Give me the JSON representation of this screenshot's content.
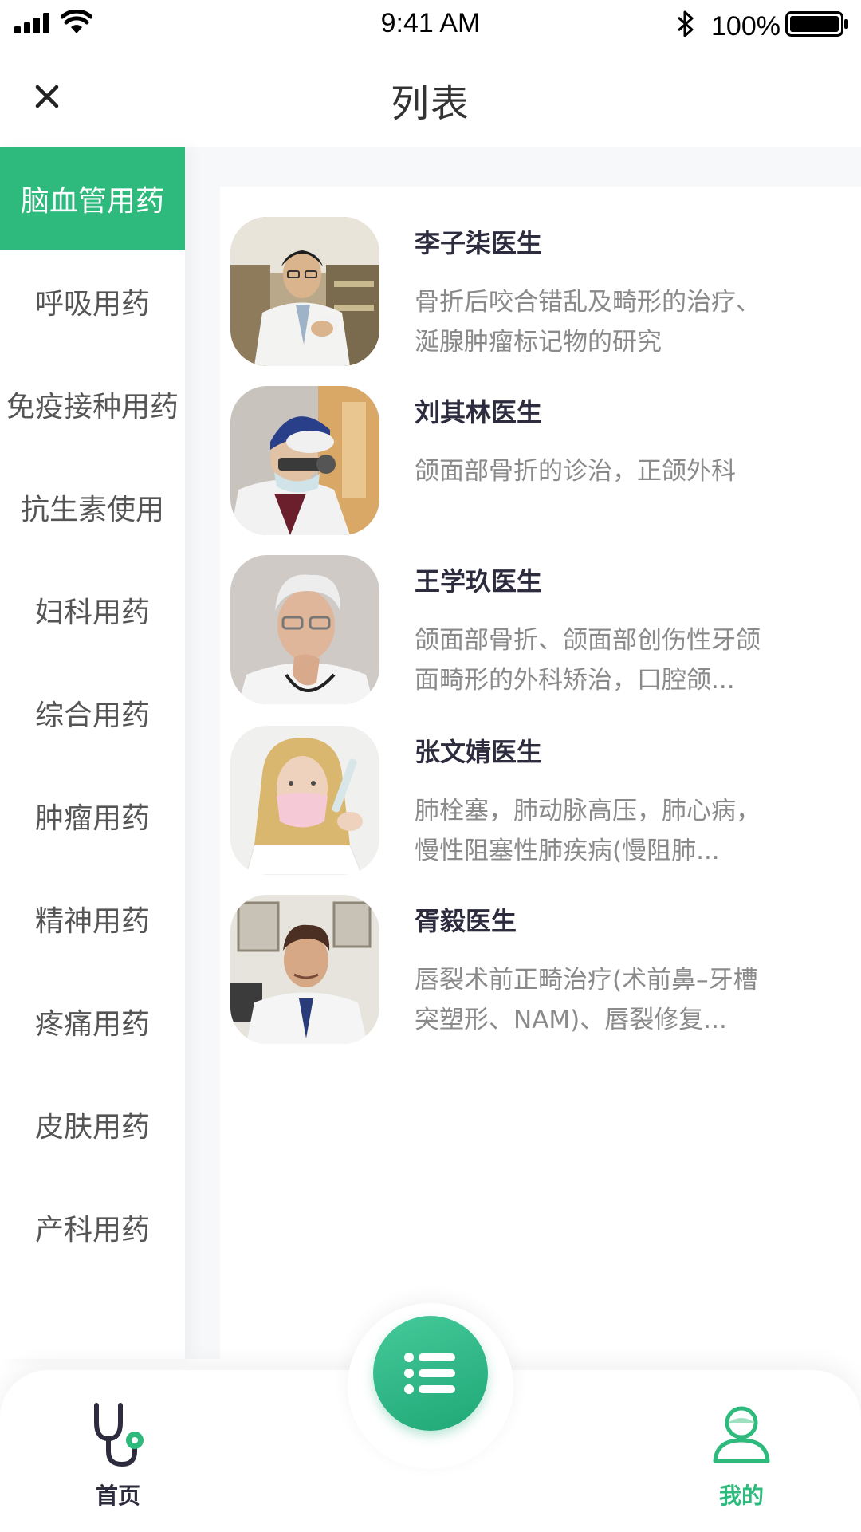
{
  "status_bar": {
    "time": "9:41 AM",
    "battery_percent": "100%",
    "icons": [
      "signal-icon",
      "wifi-icon",
      "bluetooth-icon",
      "battery-icon"
    ]
  },
  "header": {
    "title": "列表",
    "close_icon": "close-icon"
  },
  "sidebar": {
    "items": [
      {
        "label": "脑血管用药",
        "active": true
      },
      {
        "label": "呼吸用药",
        "active": false
      },
      {
        "label": "免疫接种用药",
        "active": false
      },
      {
        "label": "抗生素使用",
        "active": false
      },
      {
        "label": "妇科用药",
        "active": false
      },
      {
        "label": "综合用药",
        "active": false
      },
      {
        "label": "肿瘤用药",
        "active": false
      },
      {
        "label": "精神用药",
        "active": false
      },
      {
        "label": "疼痛用药",
        "active": false
      },
      {
        "label": "皮肤用药",
        "active": false
      },
      {
        "label": "产科用药",
        "active": false
      }
    ]
  },
  "doctors": [
    {
      "name": "李子柒医生",
      "line1": "骨折后咬合错乱及畸形的治疗、",
      "line2": "涎腺肿瘤标记物的研究"
    },
    {
      "name": "刘其林医生",
      "line1": "颌面部骨折的诊治，正颌外科",
      "line2": ""
    },
    {
      "name": "王学玖医生",
      "line1": "颌面部骨折、颌面部创伤性牙颌",
      "line2": "面畸形的外科矫治，口腔颌..."
    },
    {
      "name": "张文婧医生",
      "line1": "肺栓塞，肺动脉高压，肺心病，",
      "line2": "慢性阻塞性肺疾病(慢阻肺..."
    },
    {
      "name": "胥毅医生",
      "line1": "唇裂术前正畸治疗(术前鼻–牙槽",
      "line2": "突塑形、NAM)、唇裂修复..."
    }
  ],
  "tabbar": {
    "home_label": "首页",
    "mine_label": "我的",
    "center_icon": "list-icon"
  },
  "colors": {
    "accent": "#2dba7c",
    "text_dark": "#2c2c3e",
    "text_muted": "#8a8a8a"
  }
}
